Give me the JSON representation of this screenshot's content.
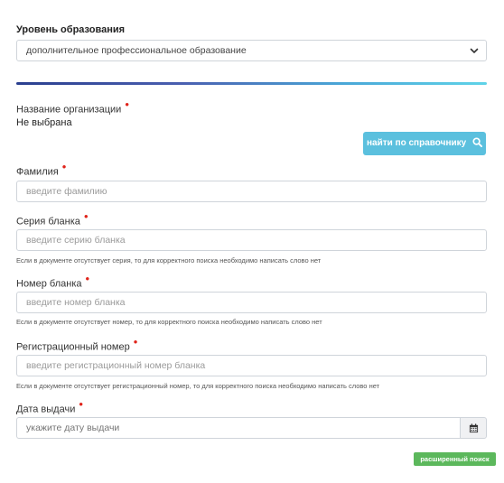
{
  "education": {
    "label": "Уровень образования",
    "selected": "дополнительное профессиональное образование"
  },
  "organization": {
    "label": "Название организации",
    "value": "Не выбрана",
    "lookup_button": "найти по справочнику"
  },
  "surname": {
    "label": "Фамилия",
    "placeholder": "введите фамилию"
  },
  "series": {
    "label": "Серия бланка",
    "placeholder": "введите серию бланка",
    "hint": "Если в документе отсутствует серия, то для корректного поиска необходимо написать слово нет"
  },
  "number": {
    "label": "Номер бланка",
    "placeholder": "введите номер бланка",
    "hint": "Если в документе отсутствует номер, то для корректного поиска необходимо написать слово нет"
  },
  "reg_number": {
    "label": "Регистрационный номер",
    "placeholder": "введите регистрационный номер бланка",
    "hint": "Если в документе отсутствует регистрационный номер, то для корректного поиска необходимо написать слово нет"
  },
  "issue_date": {
    "label": "Дата выдачи",
    "placeholder": "укажите дату выдачи"
  },
  "advanced_search": "расширенный поиск",
  "colors": {
    "required": "#e0241b",
    "info_button": "#5bc0de",
    "success_button": "#5cb85c"
  }
}
